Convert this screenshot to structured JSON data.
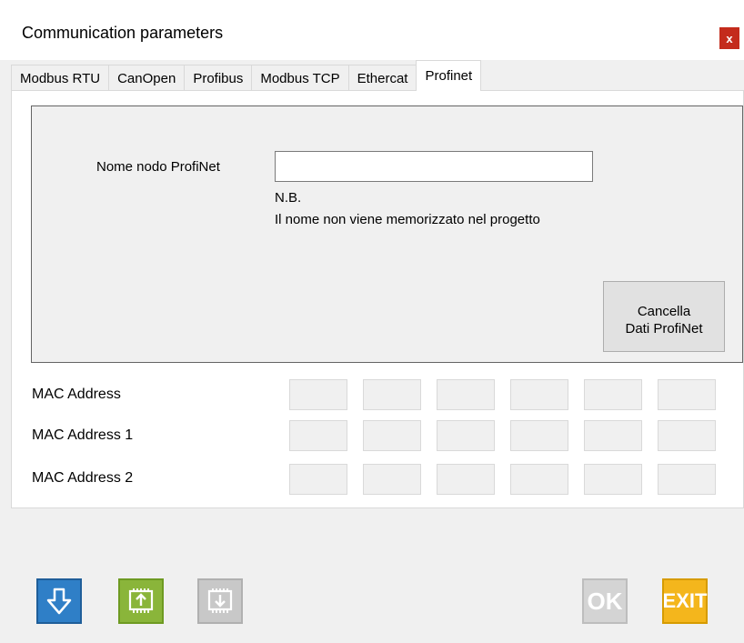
{
  "window": {
    "title": "Communication parameters",
    "close_label": "x"
  },
  "tabs": [
    {
      "label": "Modbus RTU",
      "active": false
    },
    {
      "label": "CanOpen",
      "active": false
    },
    {
      "label": "Profibus",
      "active": false
    },
    {
      "label": "Modbus TCP",
      "active": false
    },
    {
      "label": "Ethercat",
      "active": false
    },
    {
      "label": "Profinet",
      "active": true
    }
  ],
  "profinet": {
    "node_name_label": "Nome nodo ProfiNet",
    "node_name_value": "",
    "note_title": "N.B.",
    "note_text": "Il nome non viene memorizzato nel progetto",
    "clear_button": {
      "line1": "Cancella",
      "line2": "Dati ProfiNet"
    },
    "mac_rows": [
      {
        "label": "MAC Address",
        "octets": [
          "",
          "",
          "",
          "",
          "",
          ""
        ]
      },
      {
        "label": "MAC Address 1",
        "octets": [
          "",
          "",
          "",
          "",
          "",
          ""
        ]
      },
      {
        "label": "MAC Address 2",
        "octets": [
          "",
          "",
          "",
          "",
          "",
          ""
        ]
      }
    ]
  },
  "footer": {
    "ok_label": "OK",
    "exit_label": "EXIT",
    "icons": [
      "download-arrow-icon",
      "upload-device-icon",
      "download-device-icon"
    ]
  },
  "colors": {
    "close": "#c42b1c",
    "download": "#2f7fc7",
    "upload": "#8ab53a",
    "disabled": "#c8c8c8",
    "exit": "#f4b61c"
  }
}
